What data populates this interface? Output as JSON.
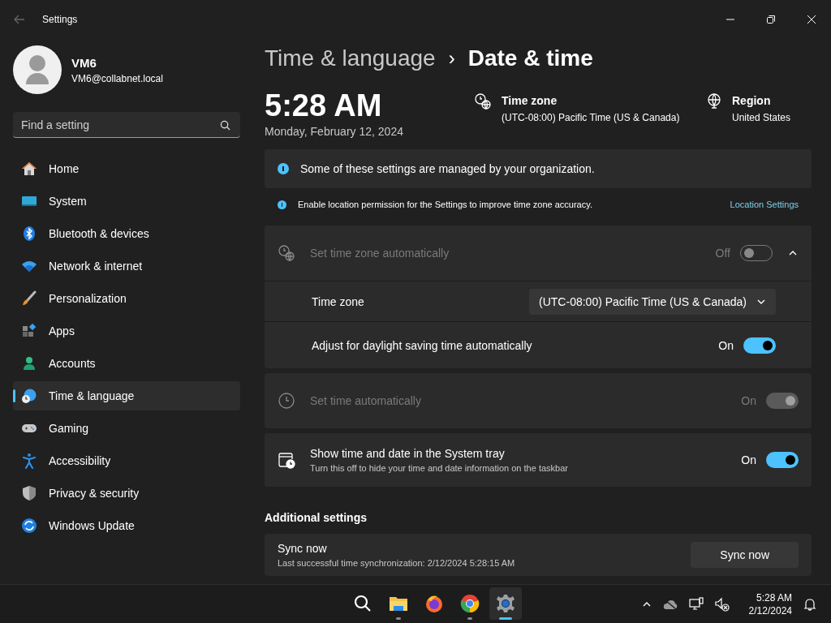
{
  "window": {
    "title": "Settings"
  },
  "user": {
    "name": "VM6",
    "email": "VM6@collabnet.local"
  },
  "search": {
    "placeholder": "Find a setting"
  },
  "nav": [
    {
      "label": "Home",
      "kind": "home",
      "selected": false
    },
    {
      "label": "System",
      "kind": "system",
      "selected": false
    },
    {
      "label": "Bluetooth & devices",
      "kind": "bluetooth",
      "selected": false
    },
    {
      "label": "Network & internet",
      "kind": "network",
      "selected": false
    },
    {
      "label": "Personalization",
      "kind": "brush",
      "selected": false
    },
    {
      "label": "Apps",
      "kind": "apps",
      "selected": false
    },
    {
      "label": "Accounts",
      "kind": "accounts",
      "selected": false
    },
    {
      "label": "Time & language",
      "kind": "time",
      "selected": true
    },
    {
      "label": "Gaming",
      "kind": "gaming",
      "selected": false
    },
    {
      "label": "Accessibility",
      "kind": "accessibility",
      "selected": false
    },
    {
      "label": "Privacy & security",
      "kind": "shield",
      "selected": false
    },
    {
      "label": "Windows Update",
      "kind": "update",
      "selected": false
    }
  ],
  "breadcrumb": {
    "parent": "Time & language",
    "separator": "›",
    "current": "Date & time"
  },
  "clock": {
    "time": "5:28 AM",
    "date": "Monday, February 12, 2024"
  },
  "summary": [
    {
      "kind": "timezone",
      "title": "Time zone",
      "value": "(UTC-08:00) Pacific Time (US & Canada)"
    },
    {
      "kind": "region",
      "title": "Region",
      "value": "United States"
    }
  ],
  "notice": {
    "text": "Some of these settings are managed by your organization."
  },
  "location_notice": {
    "text": "Enable location permission for the Settings to improve time zone accuracy.",
    "link": "Location Settings"
  },
  "cards": [
    {
      "kind": "expandable",
      "label": "Set time zone automatically",
      "status": "Off",
      "on": false,
      "disabled": true,
      "expanded": true,
      "children": [
        {
          "kind": "dropdown",
          "label": "Time zone",
          "value": "(UTC-08:00) Pacific Time (US & Canada)"
        },
        {
          "kind": "toggle",
          "label": "Adjust for daylight saving time automatically",
          "status": "On",
          "on": true
        }
      ]
    },
    {
      "kind": "toggle",
      "label": "Set time automatically",
      "status": "On",
      "on": true,
      "disabled": true
    },
    {
      "kind": "toggle",
      "label": "Show time and date in the System tray",
      "description": "Turn this off to hide your time and date information on the taskbar",
      "status": "On",
      "on": true,
      "disabled": false
    }
  ],
  "additional": {
    "heading": "Additional settings",
    "sync": {
      "label": "Sync now",
      "description": "Last successful time synchronization: 2/12/2024 5:28:15 AM",
      "button": "Sync now"
    }
  },
  "taskbar": {
    "apps": [
      {
        "kind": "search",
        "running": false,
        "active": false
      },
      {
        "kind": "explorer",
        "running": true,
        "active": false
      },
      {
        "kind": "firefox",
        "running": false,
        "active": false
      },
      {
        "kind": "chrome",
        "running": true,
        "active": false
      },
      {
        "kind": "settings",
        "running": true,
        "active": true
      }
    ],
    "time": "5:28 AM",
    "date": "2/12/2024"
  }
}
